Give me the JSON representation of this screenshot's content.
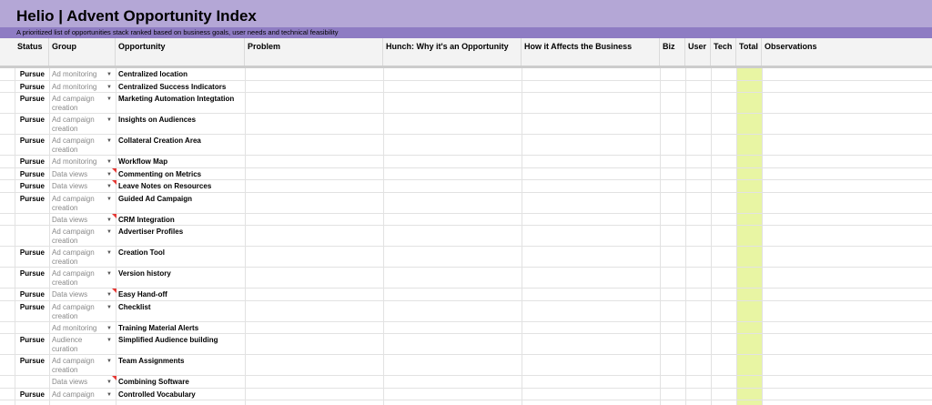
{
  "sheet": {
    "title": "Helio | Advent Opportunity Index",
    "subtitle": "A prioritized list of opportunities stack ranked based on business goals, user needs and technical feasibility"
  },
  "colors": {
    "banner": "#b4a7d6",
    "subbar": "#8e7cc3",
    "total_column": "#e8f5a3",
    "comment_marker": "#e53935"
  },
  "columns": {
    "status": "Status",
    "group": "Group",
    "opportunity": "Opportunity",
    "problem": "Problem",
    "hunch": "Hunch: Why it's an Opportunity",
    "affects": "How it Affects the Business",
    "biz": "Biz",
    "user": "User",
    "tech": "Tech",
    "total": "Total",
    "observations": "Observations"
  },
  "rows": [
    {
      "status": "Pursue",
      "group": "Ad monitoring",
      "opportunity": "Centralized location",
      "note": false
    },
    {
      "status": "Pursue",
      "group": "Ad monitoring",
      "opportunity": "Centralized Success Indicators",
      "note": false
    },
    {
      "status": "Pursue",
      "group": "Ad campaign creation",
      "opportunity": "Marketing Automation Integtation",
      "note": false
    },
    {
      "status": "Pursue",
      "group": "Ad campaign creation",
      "opportunity": "Insights on Audiences",
      "note": false
    },
    {
      "status": "Pursue",
      "group": "Ad campaign creation",
      "opportunity": "Collateral Creation Area",
      "note": false
    },
    {
      "status": "Pursue",
      "group": "Ad monitoring",
      "opportunity": "Workflow Map",
      "note": false
    },
    {
      "status": "Pursue",
      "group": "Data views",
      "opportunity": "Commenting on Metrics",
      "note": true
    },
    {
      "status": "Pursue",
      "group": "Data views",
      "opportunity": "Leave Notes on Resources",
      "note": true
    },
    {
      "status": "Pursue",
      "group": "Ad campaign creation",
      "opportunity": "Guided Ad Campaign",
      "note": false
    },
    {
      "status": "",
      "group": "Data views",
      "opportunity": "CRM Integration",
      "note": true
    },
    {
      "status": "",
      "group": "Ad campaign creation",
      "opportunity": "Advertiser Profiles",
      "note": false
    },
    {
      "status": "Pursue",
      "group": "Ad campaign creation",
      "opportunity": "Creation Tool",
      "note": false
    },
    {
      "status": "Pursue",
      "group": "Ad campaign creation",
      "opportunity": "Version history",
      "note": false
    },
    {
      "status": "Pursue",
      "group": "Data views",
      "opportunity": "Easy Hand-off",
      "note": true
    },
    {
      "status": "Pursue",
      "group": "Ad campaign creation",
      "opportunity": "Checklist",
      "note": false
    },
    {
      "status": "",
      "group": "Ad monitoring",
      "opportunity": "Training Material Alerts",
      "note": false
    },
    {
      "status": "Pursue",
      "group": "Audience curation",
      "opportunity": "Simplified Audience building",
      "note": false
    },
    {
      "status": "Pursue",
      "group": "Ad campaign creation",
      "opportunity": "Team Assignments",
      "note": false
    },
    {
      "status": "",
      "group": "Data views",
      "opportunity": "Combining Software",
      "note": true
    },
    {
      "status": "Pursue",
      "group": "Ad campaign",
      "opportunity": "Controlled Vocabulary",
      "note": false
    }
  ]
}
